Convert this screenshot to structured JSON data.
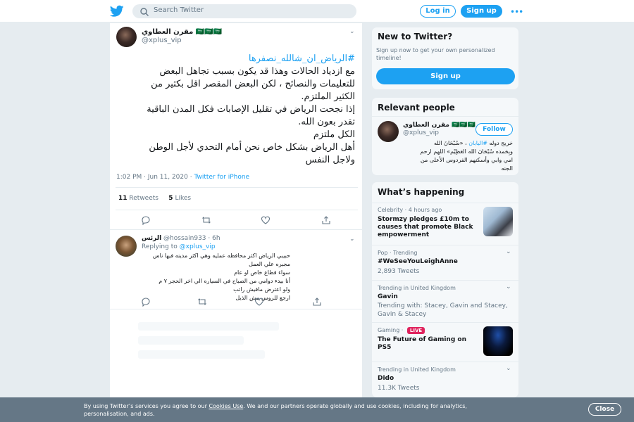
{
  "colors": {
    "brand": "#1da1f2",
    "background": "#e6ecf0",
    "banner": "#657786",
    "live": "#e0245e"
  },
  "topbar": {
    "logo_icon": "twitter-bird-icon",
    "search_placeholder": "Search Twitter",
    "login_label": "Log in",
    "signup_label": "Sign up",
    "more_icon": "more-dots-icon"
  },
  "tweet": {
    "name": "مقرن العطاوي 🇸🇦🇸🇦🇸🇦",
    "handle": "@xplus_vip",
    "hashtag": "#الرياض_ان_شالله_نصفرها",
    "lines": [
      "مع ازدياد الحالات وهذا قد يكون بسبب تجاهل البعض",
      "للتعليمات والنصائح ، لكن البعض المقصر اقل بكثير من",
      "الكثير الملتزم.",
      "إذا نجحت الرياض في تقليل الإصابات فكل المدن الباقية",
      "تقدر بعون الله.",
      "الكل ملتزم",
      "أهل الرياض بشكل خاص نحن أمام التحدي لأجل الوطن",
      "ولاجل النفس"
    ],
    "timestamp": "1:02 PM · Jun 11, 2020",
    "separator": " · ",
    "source": "Twitter for iPhone",
    "retweets_count": "11",
    "retweets_label": "Retweets",
    "likes_count": "5",
    "likes_label": "Likes"
  },
  "reply": {
    "name": "الرئس",
    "handle": "@hossain933",
    "time": "· 6h",
    "replying_to_label": "Replying to",
    "replying_to": "@xplus_vip",
    "lines": [
      "حبيبي الرياض اكثر محافظه عمليه وهي اكثر مدينه فيها ناس مجبره علي العمل",
      "سواء قطاع خاص او عام",
      "أنا بيدء دوامي من الصباح في السياره الي اخر الحجر ٧ م",
      "ولو اعترض مافيش راتب",
      "ارجع للروس مش الذيل"
    ]
  },
  "new_to_twitter": {
    "title": "New to Twitter?",
    "subtitle": "Sign up now to get your own personalized timeline!",
    "button": "Sign up"
  },
  "relevant": {
    "title": "Relevant people",
    "name": "مقرن العطاوي 🇸🇦🇸🇦🇸🇦",
    "handle": "@xplus_vip",
    "follow": "Follow",
    "bio_pre": "خريج دوله ",
    "bio_link": "#اليابان",
    "bio_post": " ، «سُبْحَانَ الله",
    "bio_lines": [
      "وبِحَمده سُبْحَانَ الله العَظِيْم» اللهم ارحم",
      "امي وابي وأسكنهم الفردوس الأعلى من",
      "الجنه"
    ]
  },
  "happening": {
    "title": "What’s happening",
    "trends": [
      {
        "meta": "Celebrity · 4 hours ago",
        "title": "Stormzy pledges £10m to causes that promote Black empowerment",
        "sub": ""
      },
      {
        "meta": "Pop · Trending",
        "title": "#WeSeeYouLeighAnne",
        "sub": "2,893 Tweets"
      },
      {
        "meta": "Trending in United Kingdom",
        "title": "Gavin",
        "sub": "Trending with: Stacey, Gavin and Stacey, Gavin & Stacey"
      },
      {
        "meta": "Gaming · ",
        "live": "LIVE",
        "title": "The Future of Gaming on PS5",
        "sub": ""
      },
      {
        "meta": "Trending in United Kingdom",
        "title": "Dido",
        "sub": "11.3K Tweets"
      }
    ]
  },
  "cookie": {
    "text_pre": "By using Twitter’s services you agree to our ",
    "link": "Cookies Use",
    "text_post": ". We and our partners operate globally and use cookies, including for analytics, personalisation, and ads.",
    "close": "Close"
  }
}
